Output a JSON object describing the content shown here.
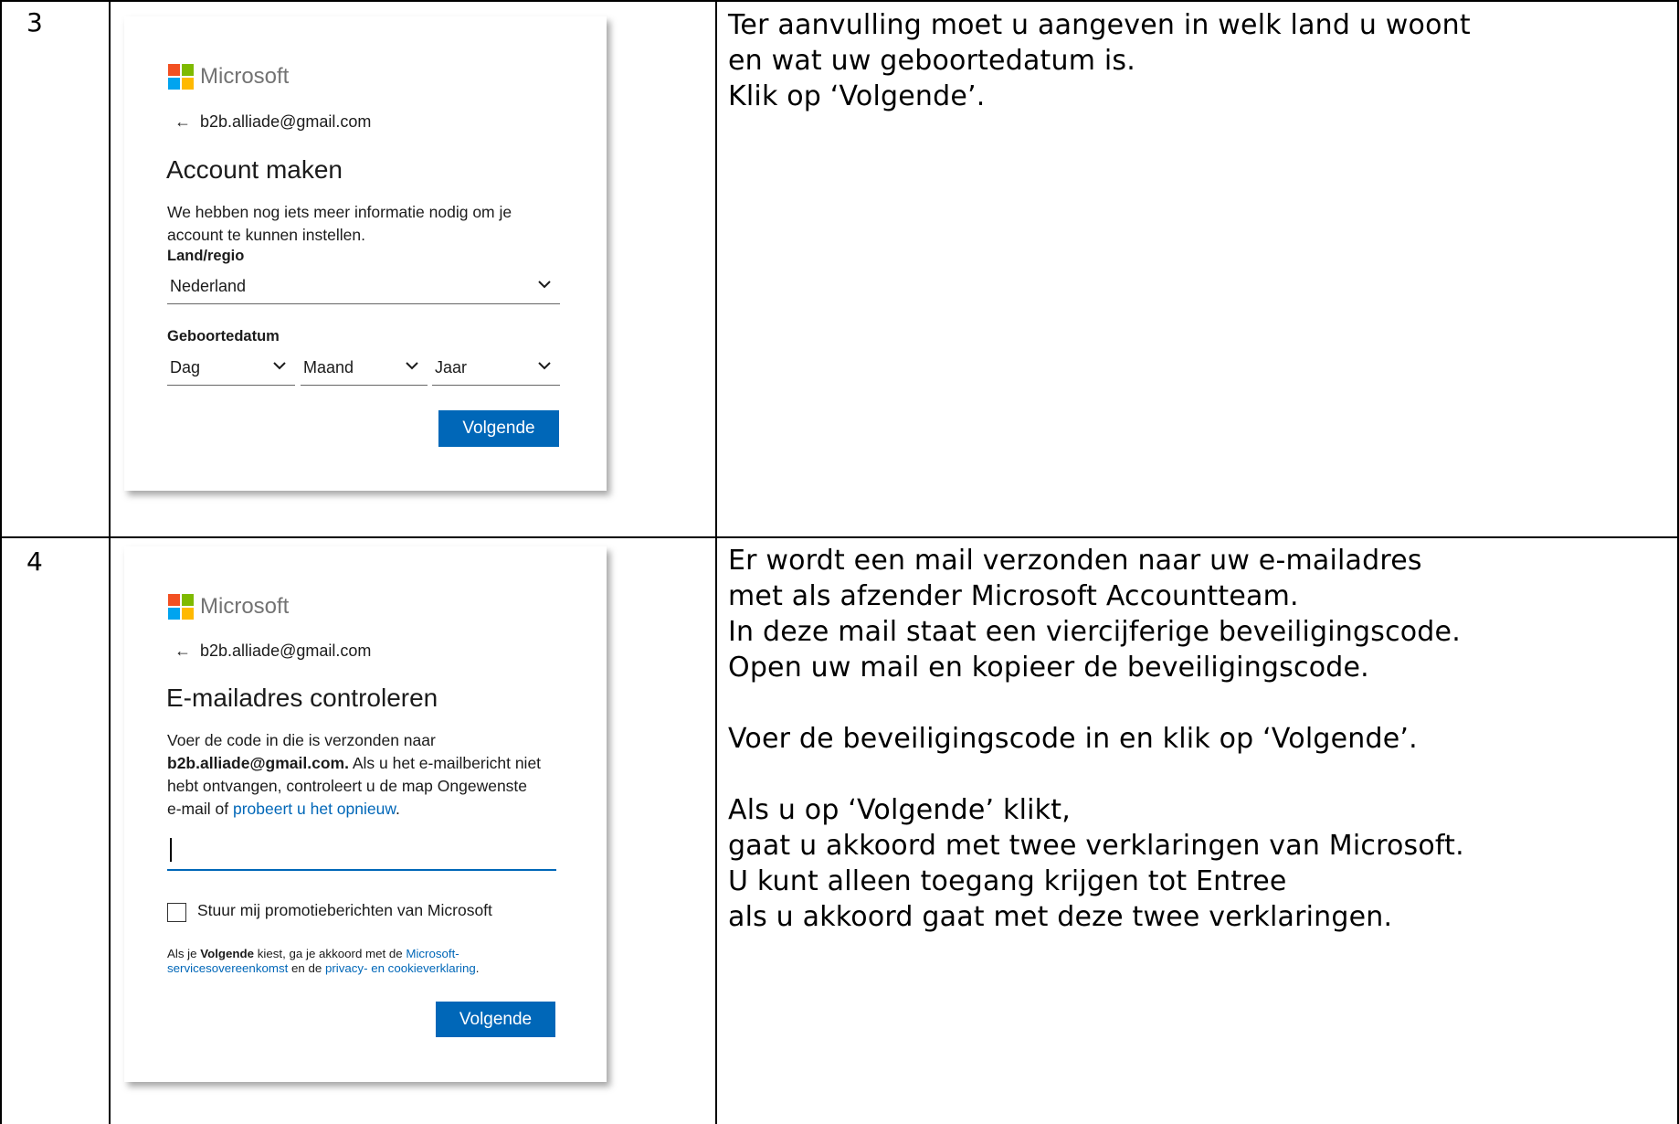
{
  "rows": [
    {
      "step": "3",
      "card": {
        "brand": "Microsoft",
        "identity": "b2b.alliade@gmail.com",
        "title": "Account maken",
        "text_line1": "We hebben nog iets meer informatie nodig om je",
        "text_line2": "account te kunnen instellen.",
        "country_label": "Land/regio",
        "country_value": "Nederland",
        "birthdate_label": "Geboortedatum",
        "day_value": "Dag",
        "month_value": "Maand",
        "year_value": "Jaar",
        "next_button": "Volgende"
      },
      "instructions": [
        "Ter aanvulling moet u aangeven in welk land u woont",
        "en wat uw geboortedatum is.",
        "Klik op ‘Volgende’."
      ]
    },
    {
      "step": "4",
      "card": {
        "brand": "Microsoft",
        "identity": "b2b.alliade@gmail.com",
        "title": "E-mailadres controleren",
        "text_line1": "Voer de code in die is verzonden naar",
        "text_bold_email": "b2b.alliade@gmail.com.",
        "text_line2_rest": " Als u het e-mailbericht niet",
        "text_line3": "hebt ontvangen, controleert u de map Ongewenste",
        "text_line4_prefix": "e-mail of ",
        "retry_link": "probeert u het opnieuw",
        "text_line4_suffix": ".",
        "code_value": "",
        "promo_label": "Stuur mij promotieberichten van Microsoft",
        "legal_prefix": "Als je ",
        "legal_bold": "Volgende",
        "legal_mid": " kiest, ga je akkoord met de ",
        "legal_link1_part1": "Microsoft-",
        "legal_link1_part2": "servicesovereenkomst",
        "legal_and": " en de ",
        "legal_link2": "privacy- en cookieverklaring",
        "legal_end": ".",
        "next_button": "Volgende"
      },
      "instructions": [
        "Er wordt een mail verzonden naar uw e-mailadres",
        "met als afzender Microsoft Accountteam.",
        "In deze mail staat een viercijferige beveiligingscode.",
        "Open uw mail en kopieer de beveiligingscode.",
        "",
        "Voer de beveiligingscode in en klik op ‘Volgende’.",
        "",
        "Als u op ‘Volgende’ klikt,",
        "gaat u akkoord met twee verklaringen van Microsoft.",
        "U kunt alleen toegang krijgen tot Entree",
        "als u akkoord gaat met deze twee verklaringen."
      ]
    }
  ],
  "colors": {
    "accent": "#0067b8",
    "ms_red": "#f25022",
    "ms_green": "#7fba00",
    "ms_blue": "#00a4ef",
    "ms_yellow": "#ffb900"
  }
}
